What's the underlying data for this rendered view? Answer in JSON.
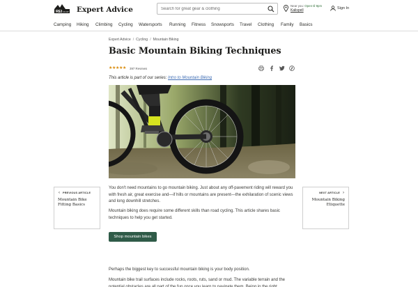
{
  "header": {
    "brand": "Expert Advice",
    "logo_text": "REI CO-OP",
    "search_placeholder": "Search for great gear & clothing",
    "store_near_prefix": "Near you: ",
    "store_open": "Open til 9pm",
    "store_name": "Kalispell",
    "signin": "Sign In"
  },
  "nav": {
    "items": [
      "Camping",
      "Hiking",
      "Climbing",
      "Cycling",
      "Watersports",
      "Running",
      "Fitness",
      "Snowsports",
      "Travel",
      "Clothing",
      "Family",
      "Basics"
    ]
  },
  "article": {
    "breadcrumb": [
      "Expert Advice",
      "Cycling",
      "Mountain Biking"
    ],
    "title": "Basic Mountain Biking Techniques",
    "rating": 4.5,
    "stars": "★★★★★",
    "review_count": "397 Reviews",
    "share_icons": [
      "print-icon",
      "facebook-icon",
      "twitter-icon",
      "pinterest-icon"
    ],
    "series_prefix": "This article is part of our series: ",
    "series_link": "Intro to Mountain Biking",
    "paragraphs": [
      "You don't need mountains to go mountain biking. Just about any off-pavement riding will reward you with fresh air, great exercise and—if hills or mountains are present—the exhilaration of scenic views and long downhill stretches.",
      "Mountain biking does require some different skills than road cycling. This article shares basic techniques to help you get started.",
      "Perhaps the biggest key to successful mountain biking is your body position.",
      "Mountain bike trail surfaces include rocks, roots, ruts, sand or mud. The variable terrain and the potential obstacles are all part of the fun once you learn to navigate them. Being in the right"
    ],
    "shop_button": "Shop mountain bikes"
  },
  "prev": {
    "kicker": "PREVIOUS ARTICLE",
    "title": "Mountain Bike Fitting Basics",
    "arrow": "‹"
  },
  "next": {
    "kicker": "NEXT ARTICLE",
    "title": "Mountain Biking Etiquette",
    "arrow": "›"
  },
  "colors": {
    "button": "#2f5b48",
    "link": "#406eb5",
    "star": "#d98b0b"
  }
}
